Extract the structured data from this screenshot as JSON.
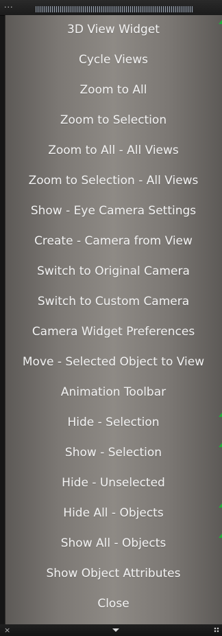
{
  "titlebar": {
    "menu_icon": "dots-icon",
    "grip_icon": "drag-grip-icon"
  },
  "menu": {
    "items": [
      {
        "label": "3D View Widget",
        "checked": true
      },
      {
        "label": "Cycle Views",
        "checked": false
      },
      {
        "label": "Zoom to All",
        "checked": false
      },
      {
        "label": "Zoom to Selection",
        "checked": false
      },
      {
        "label": "Zoom to All - All Views",
        "checked": false
      },
      {
        "label": "Zoom to Selection - All  Views",
        "checked": false
      },
      {
        "label": "Show - Eye Camera Settings",
        "checked": false
      },
      {
        "label": "Create - Camera from View",
        "checked": false
      },
      {
        "label": "Switch to Original Camera",
        "checked": false
      },
      {
        "label": "Switch to Custom Camera",
        "checked": false
      },
      {
        "label": "Camera Widget Preferences",
        "checked": false
      },
      {
        "label": "Move - Selected Object to View",
        "checked": false
      },
      {
        "label": "Animation Toolbar",
        "checked": false
      },
      {
        "label": "Hide - Selection",
        "checked": true
      },
      {
        "label": "Show - Selection",
        "checked": true
      },
      {
        "label": "Hide - Unselected",
        "checked": false
      },
      {
        "label": "Hide All - Objects",
        "checked": true
      },
      {
        "label": "Show All - Objects",
        "checked": true
      },
      {
        "label": "Show Object Attributes",
        "checked": false
      },
      {
        "label": "Close",
        "checked": false
      }
    ]
  },
  "bottombar": {
    "close_icon": "close-icon",
    "expand_icon": "chevron-down-icon",
    "resize_icon": "resize-grip-icon"
  },
  "colors": {
    "menu_text": "#f2f2f2",
    "check_green": "#1fae3a",
    "panel_dark": "#161616"
  }
}
